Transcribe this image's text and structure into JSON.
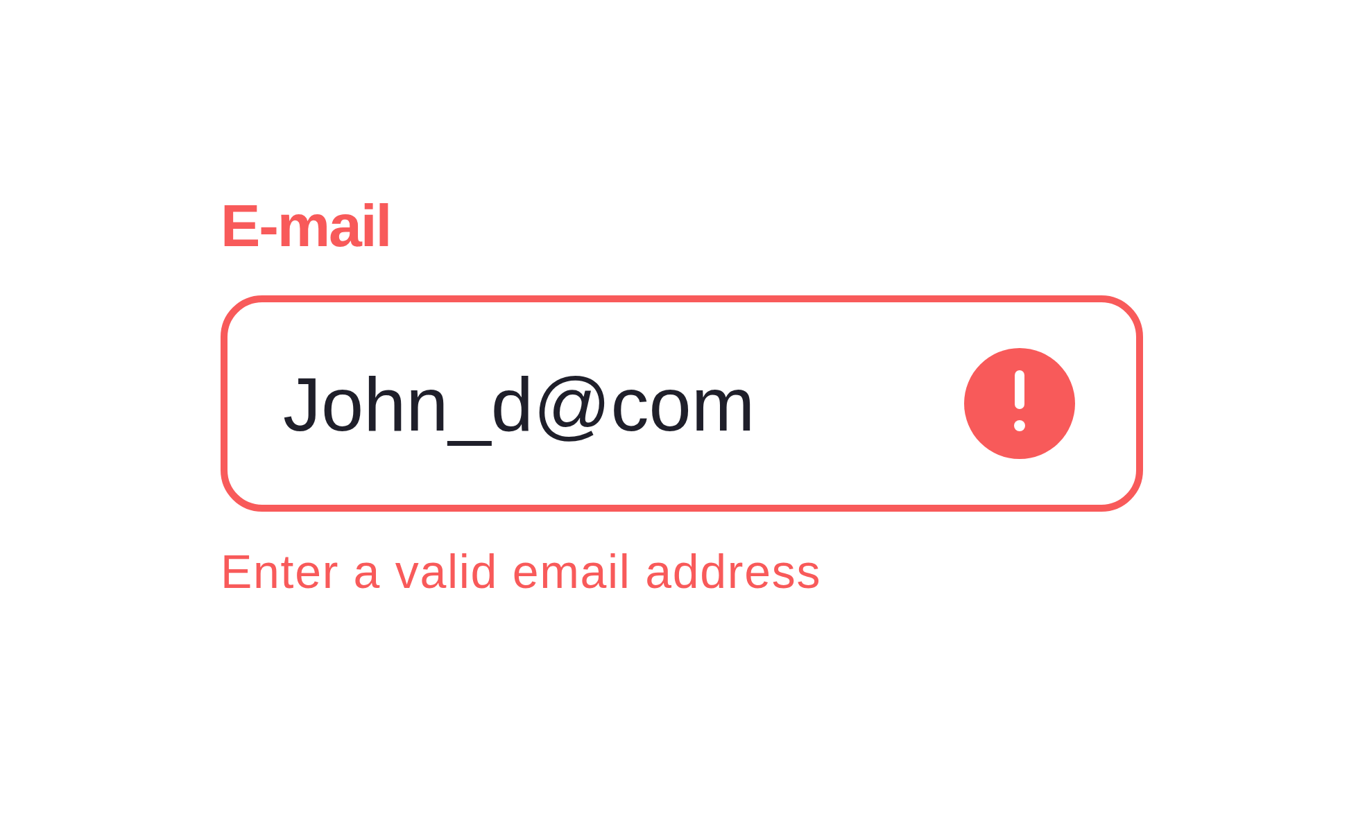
{
  "field": {
    "label": "E-mail",
    "value": "John_d@com",
    "invalid": true,
    "error": "Enter a valid email address"
  }
}
